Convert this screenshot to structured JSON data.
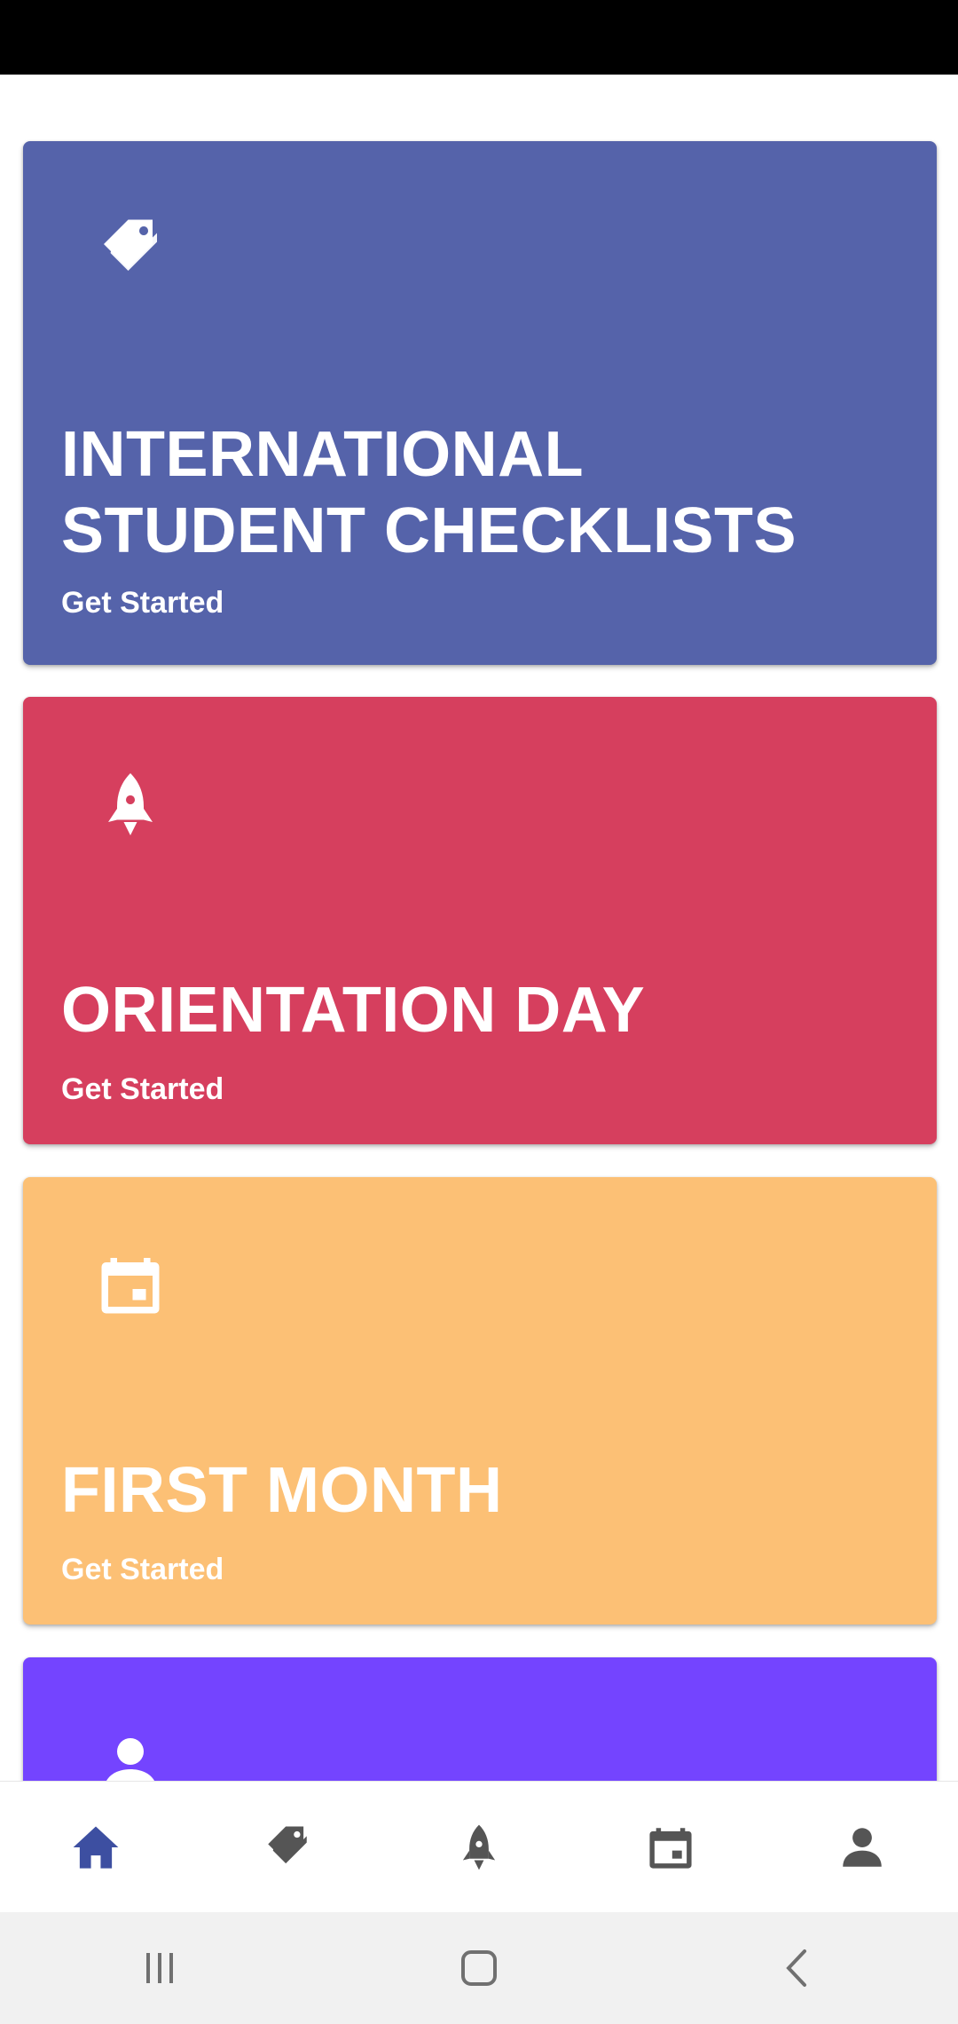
{
  "colors": {
    "card1": "#5563AA",
    "card2": "#D63F5E",
    "card3": "#FCC075",
    "card4": "#7444FF",
    "nav_active": "#3D4FA1",
    "nav_inactive": "#555555",
    "system_icons": "#707070"
  },
  "cards": [
    {
      "icon": "tags-icon",
      "title": "INTERNATIONAL STUDENT CHECKLISTS",
      "cta": "Get Started"
    },
    {
      "icon": "rocket-icon",
      "title": "ORIENTATION DAY",
      "cta": "Get Started"
    },
    {
      "icon": "calendar-icon",
      "title": "FIRST MONTH",
      "cta": "Get Started"
    },
    {
      "icon": "person-icon"
    }
  ],
  "bottom_nav": {
    "items": [
      {
        "icon": "home-icon",
        "active": true
      },
      {
        "icon": "tags-icon",
        "active": false
      },
      {
        "icon": "rocket-icon",
        "active": false
      },
      {
        "icon": "calendar-icon",
        "active": false
      },
      {
        "icon": "person-icon",
        "active": false
      }
    ]
  },
  "system_nav": [
    "recent-apps-icon",
    "home-button-icon",
    "back-icon"
  ]
}
